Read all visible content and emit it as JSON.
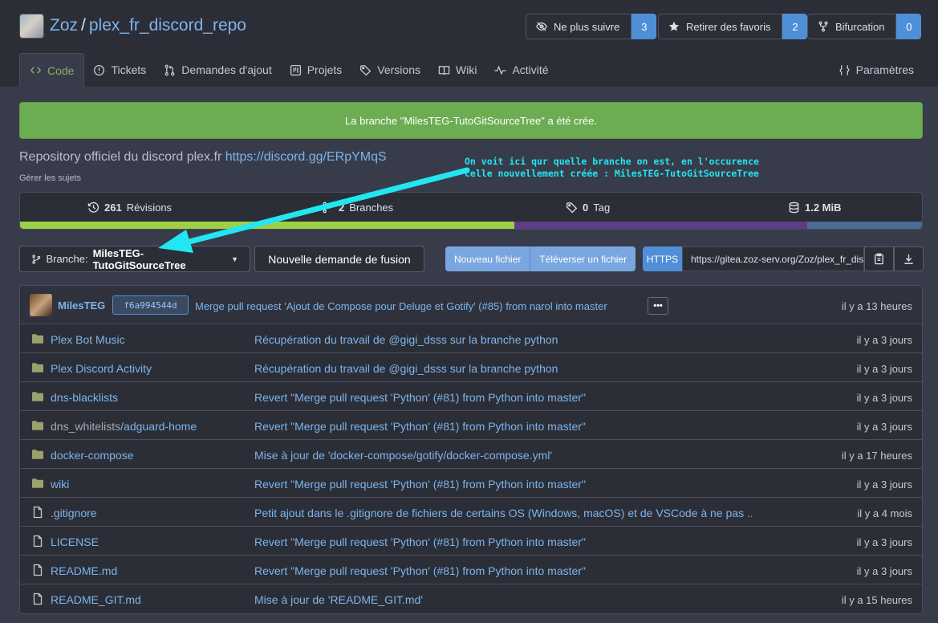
{
  "repo": {
    "owner": "Zoz",
    "separator": "/",
    "name": "plex_fr_discord_repo"
  },
  "header_buttons": {
    "watch_label": "Ne plus suivre",
    "watch_count": "3",
    "star_label": "Retirer des favoris",
    "star_count": "2",
    "fork_label": "Bifurcation",
    "fork_count": "0"
  },
  "tabs": {
    "code": "Code",
    "issues": "Tickets",
    "pulls": "Demandes d'ajout",
    "projects": "Projets",
    "releases": "Versions",
    "wiki": "Wiki",
    "activity": "Activité",
    "settings": "Paramètres"
  },
  "flash": "La branche \"MilesTEG-TutoGitSourceTree\" a été crée.",
  "description": {
    "text": "Repository officiel du discord plex.fr",
    "link": "https://discord.gg/ERpYMqS",
    "manage_topics": "Gérer les sujets"
  },
  "annotation": {
    "line1": "On voit ici qur quelle branche on est, en l'occurence",
    "line2": "celle nouvellement créée : MilesTEG-TutoGitSourceTree",
    "color": "#22e6f2"
  },
  "stats": {
    "commits_count": "261",
    "commits_label": "Révisions",
    "branches_count": "2",
    "branches_label": "Branches",
    "tags_count": "0",
    "tags_label": "Tag",
    "size": "1.2 MiB"
  },
  "language_bar": [
    {
      "color": "#9ed046",
      "share": 0.548
    },
    {
      "color": "#5e3d87",
      "share": 0.325
    },
    {
      "color": "#4c6b96",
      "share": 0.127
    }
  ],
  "toolbar": {
    "branch_prefix": "Branche:",
    "branch_name": "MilesTEG-TutoGitSourceTree",
    "new_pr": "Nouvelle demande de fusion",
    "new_file": "Nouveau fichier",
    "upload_file": "Téléverser un fichier",
    "clone_protocol": "HTTPS",
    "clone_url": "https://gitea.zoz-serv.org/Zoz/plex_fr_discord_repo.git"
  },
  "latest_commit": {
    "author": "MilesTEG",
    "sha": "f6a994544d",
    "message": "Merge pull request 'Ajout de Compose pour Deluge et Gotify' (#85) from narol into master",
    "ellipsis": "•••",
    "time": "il y a 13 heures"
  },
  "files": [
    {
      "type": "dir",
      "name": "Plex Bot Music",
      "name_prefix": "",
      "message": "Récupération du travail de @gigi_dsss sur la branche python",
      "time": "il y a 3 jours"
    },
    {
      "type": "dir",
      "name": "Plex Discord Activity",
      "name_prefix": "",
      "message": "Récupération du travail de @gigi_dsss sur la branche python",
      "time": "il y a 3 jours"
    },
    {
      "type": "dir",
      "name": "dns-blacklists",
      "name_prefix": "",
      "message": "Revert \"Merge pull request 'Python' (#81) from Python into master\"",
      "time": "il y a 3 jours"
    },
    {
      "type": "dir",
      "name": "adguard-home",
      "name_prefix": "dns_whitelists/",
      "message": "Revert \"Merge pull request 'Python' (#81) from Python into master\"",
      "time": "il y a 3 jours"
    },
    {
      "type": "dir",
      "name": "docker-compose",
      "name_prefix": "",
      "message": "Mise à jour de 'docker-compose/gotify/docker-compose.yml'",
      "time": "il y a 17 heures"
    },
    {
      "type": "dir",
      "name": "wiki",
      "name_prefix": "",
      "message": "Revert \"Merge pull request 'Python' (#81) from Python into master\"",
      "time": "il y a 3 jours"
    },
    {
      "type": "file",
      "name": ".gitignore",
      "name_prefix": "",
      "message": "Petit ajout dans le .gitignore de fichiers de certains OS (Windows, macOS) et de VSCode à ne pas ...",
      "time": "il y a 4 mois"
    },
    {
      "type": "file",
      "name": "LICENSE",
      "name_prefix": "",
      "message": "Revert \"Merge pull request 'Python' (#81) from Python into master\"",
      "time": "il y a 3 jours"
    },
    {
      "type": "file",
      "name": "README.md",
      "name_prefix": "",
      "message": "Revert \"Merge pull request 'Python' (#81) from Python into master\"",
      "time": "il y a 3 jours"
    },
    {
      "type": "file",
      "name": "README_GIT.md",
      "name_prefix": "",
      "message": "Mise à jour de 'README_GIT.md'",
      "time": "il y a 15 heures"
    }
  ]
}
